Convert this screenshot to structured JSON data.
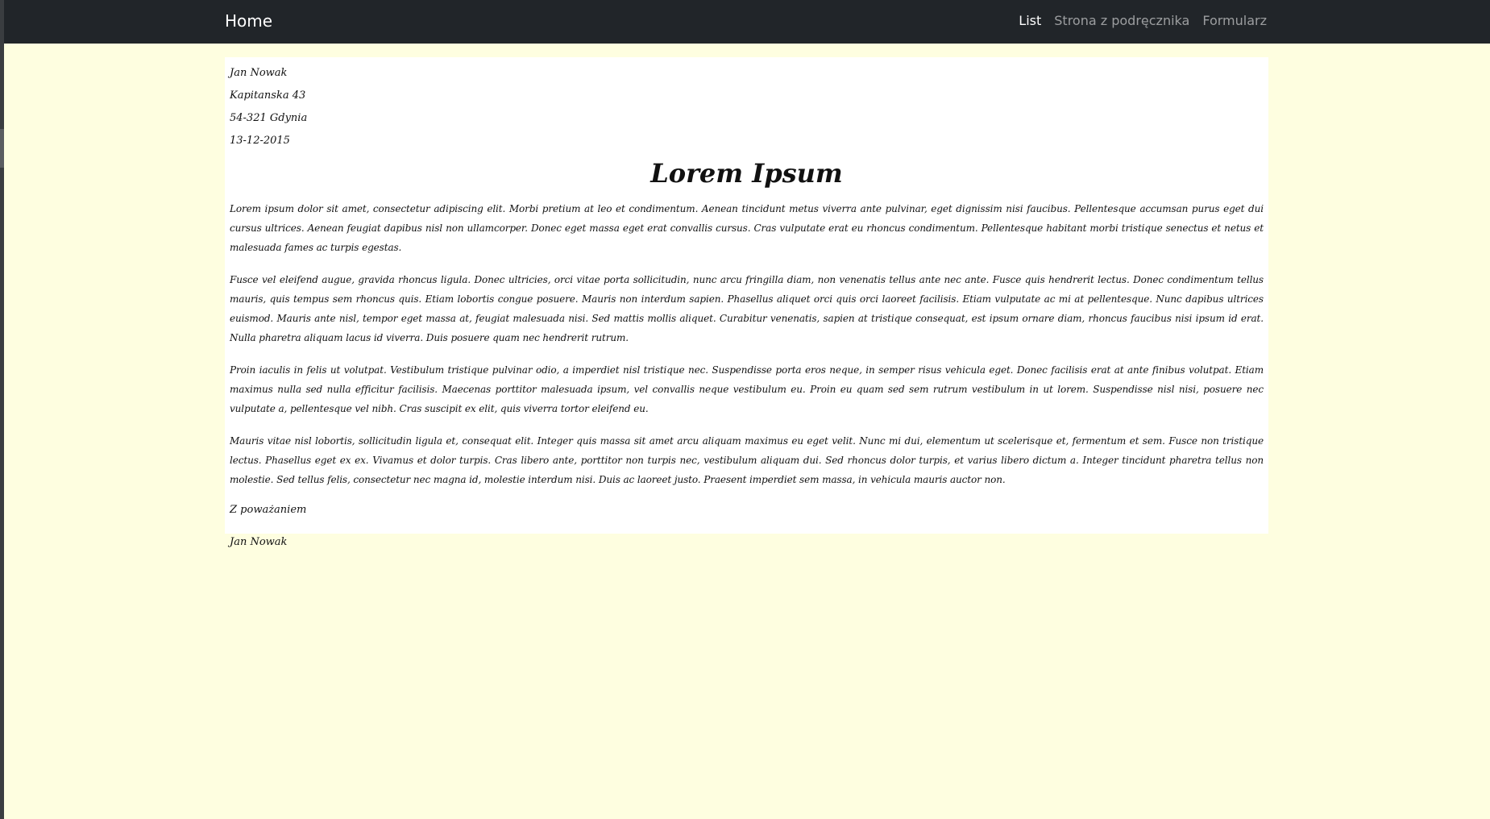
{
  "navbar": {
    "brand": "Home",
    "links": [
      {
        "label": "List",
        "active": true
      },
      {
        "label": "Strona z podręcznika",
        "active": false
      },
      {
        "label": "Formularz",
        "active": false
      }
    ],
    "bg_color": "#212529"
  },
  "page": {
    "bg_color": "#fefee0",
    "paper_color": "#ffffff"
  },
  "letter": {
    "sender_name": "Jan Nowak",
    "street": "Kapitanska 43",
    "city": "54-321 Gdynia",
    "date": "13-12-2015",
    "title": "Lorem Ipsum",
    "paragraphs": [
      "Lorem ipsum dolor sit amet, consectetur adipiscing elit. Morbi pretium at leo et condimentum. Aenean tincidunt metus viverra ante pulvinar, eget dignissim nisi faucibus. Pellentesque accumsan purus eget dui cursus ultrices. Aenean feugiat dapibus nisl non ullamcorper. Donec eget massa eget erat convallis cursus. Cras vulputate erat eu rhoncus condimentum. Pellentesque habitant morbi tristique senectus et netus et malesuada fames ac turpis egestas.",
      "Fusce vel eleifend augue, gravida rhoncus ligula. Donec ultricies, orci vitae porta sollicitudin, nunc arcu fringilla diam, non venenatis tellus ante nec ante. Fusce quis hendrerit lectus. Donec condimentum tellus mauris, quis tempus sem rhoncus quis. Etiam lobortis congue posuere. Mauris non interdum sapien. Phasellus aliquet orci quis orci laoreet facilisis. Etiam vulputate ac mi at pellentesque. Nunc dapibus ultrices euismod. Mauris ante nisl, tempor eget massa at, feugiat malesuada nisi. Sed mattis mollis aliquet. Curabitur venenatis, sapien at tristique consequat, est ipsum ornare diam, rhoncus faucibus nisi ipsum id erat. Nulla pharetra aliquam lacus id viverra. Duis posuere quam nec hendrerit rutrum.",
      "Proin iaculis in felis ut volutpat. Vestibulum tristique pulvinar odio, a imperdiet nisl tristique nec. Suspendisse porta eros neque, in semper risus vehicula eget. Donec facilisis erat at ante finibus volutpat. Etiam maximus nulla sed nulla efficitur facilisis. Maecenas porttitor malesuada ipsum, vel convallis neque vestibulum eu. Proin eu quam sed sem rutrum vestibulum in ut lorem. Suspendisse nisl nisi, posuere nec vulputate a, pellentesque vel nibh. Cras suscipit ex elit, quis viverra tortor eleifend eu.",
      "Mauris vitae nisl lobortis, sollicitudin ligula et, consequat elit. Integer quis massa sit amet arcu aliquam maximus eu eget velit. Nunc mi dui, elementum ut scelerisque et, fermentum et sem. Fusce non tristique lectus. Phasellus eget ex ex. Vivamus et dolor turpis. Cras libero ante, porttitor non turpis nec, vestibulum aliquam dui. Sed rhoncus dolor turpis, et varius libero dictum a. Integer tincidunt pharetra tellus non molestie. Sed tellus felis, consectetur nec magna id, molestie interdum nisi. Duis ac laoreet justo. Praesent imperdiet sem massa, in vehicula mauris auctor non."
    ],
    "closing": "Z poważaniem",
    "signature": "Jan Nowak"
  }
}
